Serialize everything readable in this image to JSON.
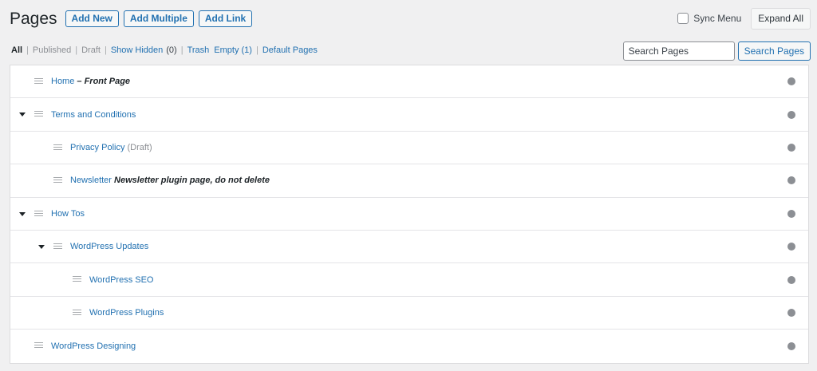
{
  "header": {
    "title": "Pages",
    "add_new": "Add New",
    "add_multiple": "Add Multiple",
    "add_link": "Add Link",
    "sync_menu": "Sync Menu",
    "expand_all": "Expand All"
  },
  "filters": {
    "all": "All",
    "published": "Published",
    "draft": "Draft",
    "show_hidden": "Show Hidden",
    "show_hidden_count": "(0)",
    "trash": "Trash",
    "empty": "Empty (1)",
    "default_pages": "Default Pages"
  },
  "search": {
    "placeholder": "Search Pages",
    "button": "Search Pages"
  },
  "rows": [
    {
      "title": "Home",
      "suffix_dash": " – ",
      "suffix_bold": "Front Page",
      "status": "",
      "depth": 0,
      "expandable": false
    },
    {
      "title": "Terms and Conditions",
      "suffix_dash": "",
      "suffix_bold": "",
      "status": "",
      "depth": 0,
      "expandable": true
    },
    {
      "title": "Privacy Policy",
      "suffix_dash": "",
      "suffix_bold": "",
      "status": "(Draft)",
      "depth": 1,
      "expandable": false
    },
    {
      "title": "Newsletter",
      "suffix_dash": " ",
      "suffix_bold": "Newsletter plugin page, do not delete",
      "status": "",
      "depth": 1,
      "expandable": false
    },
    {
      "title": "How Tos",
      "suffix_dash": "",
      "suffix_bold": "",
      "status": "",
      "depth": 0,
      "expandable": true
    },
    {
      "title": "WordPress Updates",
      "suffix_dash": "",
      "suffix_bold": "",
      "status": "",
      "depth": 1,
      "expandable": true
    },
    {
      "title": "WordPress SEO",
      "suffix_dash": "",
      "suffix_bold": "",
      "status": "",
      "depth": 2,
      "expandable": false
    },
    {
      "title": "WordPress Plugins",
      "suffix_dash": "",
      "suffix_bold": "",
      "status": "",
      "depth": 2,
      "expandable": false
    },
    {
      "title": "WordPress Designing",
      "suffix_dash": "",
      "suffix_bold": "",
      "status": "",
      "depth": 0,
      "expandable": false
    }
  ],
  "colors": {
    "link": "#2271b1",
    "background": "#f0f0f1",
    "dot": "#8c8f94"
  }
}
